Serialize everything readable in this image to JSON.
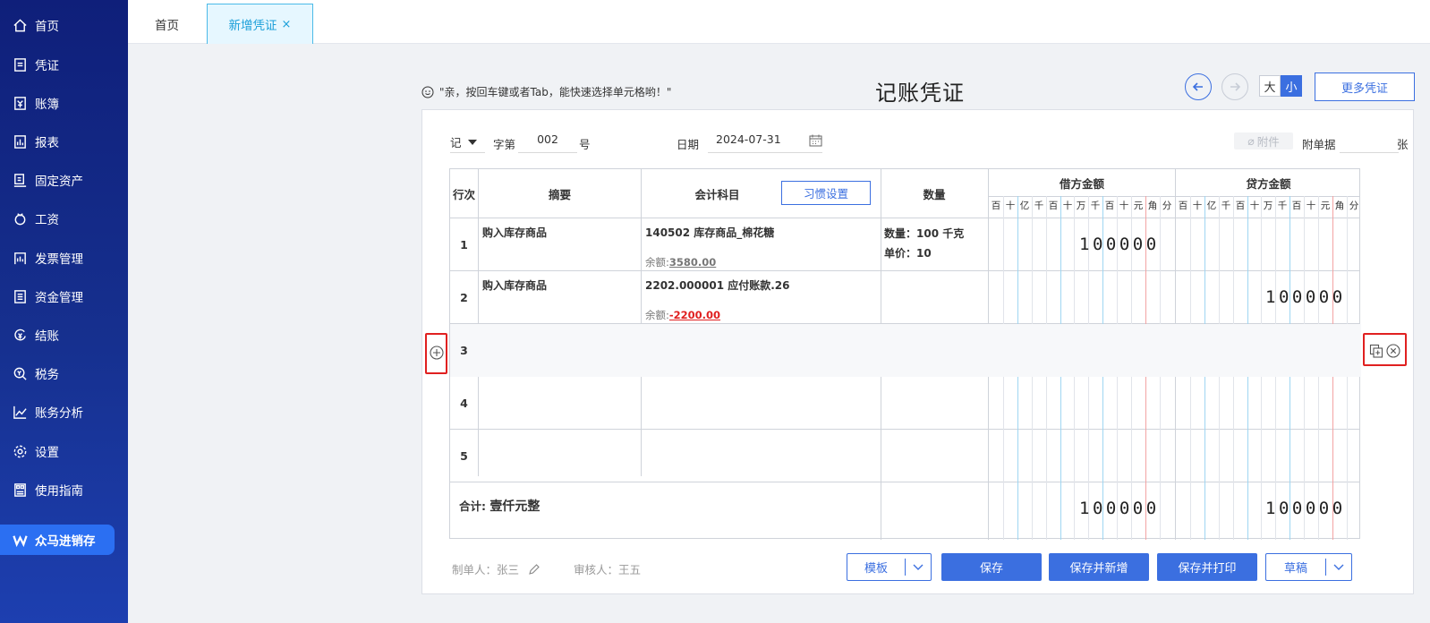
{
  "sidebar": {
    "items": [
      {
        "label": "首页",
        "icon": "home-icon"
      },
      {
        "label": "凭证",
        "icon": "voucher-icon"
      },
      {
        "label": "账簿",
        "icon": "ledger-icon"
      },
      {
        "label": "报表",
        "icon": "report-icon"
      },
      {
        "label": "固定资产",
        "icon": "fixed-asset-icon"
      },
      {
        "label": "工资",
        "icon": "salary-icon"
      },
      {
        "label": "发票管理",
        "icon": "invoice-icon"
      },
      {
        "label": "资金管理",
        "icon": "fund-icon"
      },
      {
        "label": "结账",
        "icon": "closing-icon"
      },
      {
        "label": "税务",
        "icon": "tax-icon"
      },
      {
        "label": "账务分析",
        "icon": "analysis-icon"
      },
      {
        "label": "设置",
        "icon": "settings-icon"
      },
      {
        "label": "使用指南",
        "icon": "guide-icon"
      }
    ],
    "brand": "众马进销存"
  },
  "tabs": {
    "home": "首页",
    "active": "新增凭证",
    "close": "×"
  },
  "tip": "\"亲，按回车键或者Tab，能快速选择单元格哟！\"",
  "title": "记账凭证",
  "size_toggle": {
    "big": "大",
    "small": "小"
  },
  "more_button": "更多凭证",
  "header": {
    "voucher_word": "记",
    "word_label": "字第",
    "number": "002",
    "number_suffix": "号",
    "date_label": "日期",
    "date": "2024-07-31",
    "attachment": "附件",
    "doc_count_label": "附单据",
    "doc_count_unit": "张"
  },
  "table": {
    "col_row": "行次",
    "col_summary": "摘要",
    "col_account": "会计科目",
    "habit_button": "习惯设置",
    "col_quantity": "数量",
    "col_debit": "借方金额",
    "col_credit": "贷方金额",
    "digit_units": [
      "百",
      "十",
      "亿",
      "千",
      "百",
      "十",
      "万",
      "千",
      "百",
      "十",
      "元",
      "角",
      "分"
    ],
    "rows": [
      {
        "no": "1",
        "summary": "购入库存商品",
        "account": "140502 库存商品_棉花糖",
        "balance_label": "余额:",
        "balance": "3580.00",
        "qty_line1": "数量：100 千克",
        "qty_line2": "单价：10",
        "debit": "100000",
        "credit": ""
      },
      {
        "no": "2",
        "summary": "购入库存商品",
        "account": "2202.000001 应付账款.26",
        "balance_label": "余额:",
        "balance": "-2200.00",
        "qty_line1": "",
        "qty_line2": "",
        "debit": "",
        "credit": "100000"
      },
      {
        "no": "3",
        "summary": "",
        "account": "",
        "debit": "",
        "credit": ""
      },
      {
        "no": "4",
        "summary": "",
        "account": "",
        "debit": "",
        "credit": ""
      },
      {
        "no": "5",
        "summary": "",
        "account": "",
        "debit": "",
        "credit": ""
      }
    ],
    "total_label": "合计:",
    "total_words": "壹仟元整",
    "total_debit": "100000",
    "total_credit": "100000"
  },
  "footer": {
    "maker_label": "制单人：",
    "maker": "张三",
    "reviewer_label": "审核人：",
    "reviewer": "王五"
  },
  "buttons": {
    "template": "模板",
    "save": "保存",
    "save_new": "保存并新增",
    "save_print": "保存并打印",
    "draft": "草稿"
  },
  "colors": {
    "sidebar": "#16308f",
    "primary": "#3b6fe0",
    "highlight": "#e02020",
    "tab_active_bg": "#e6f7ff"
  }
}
